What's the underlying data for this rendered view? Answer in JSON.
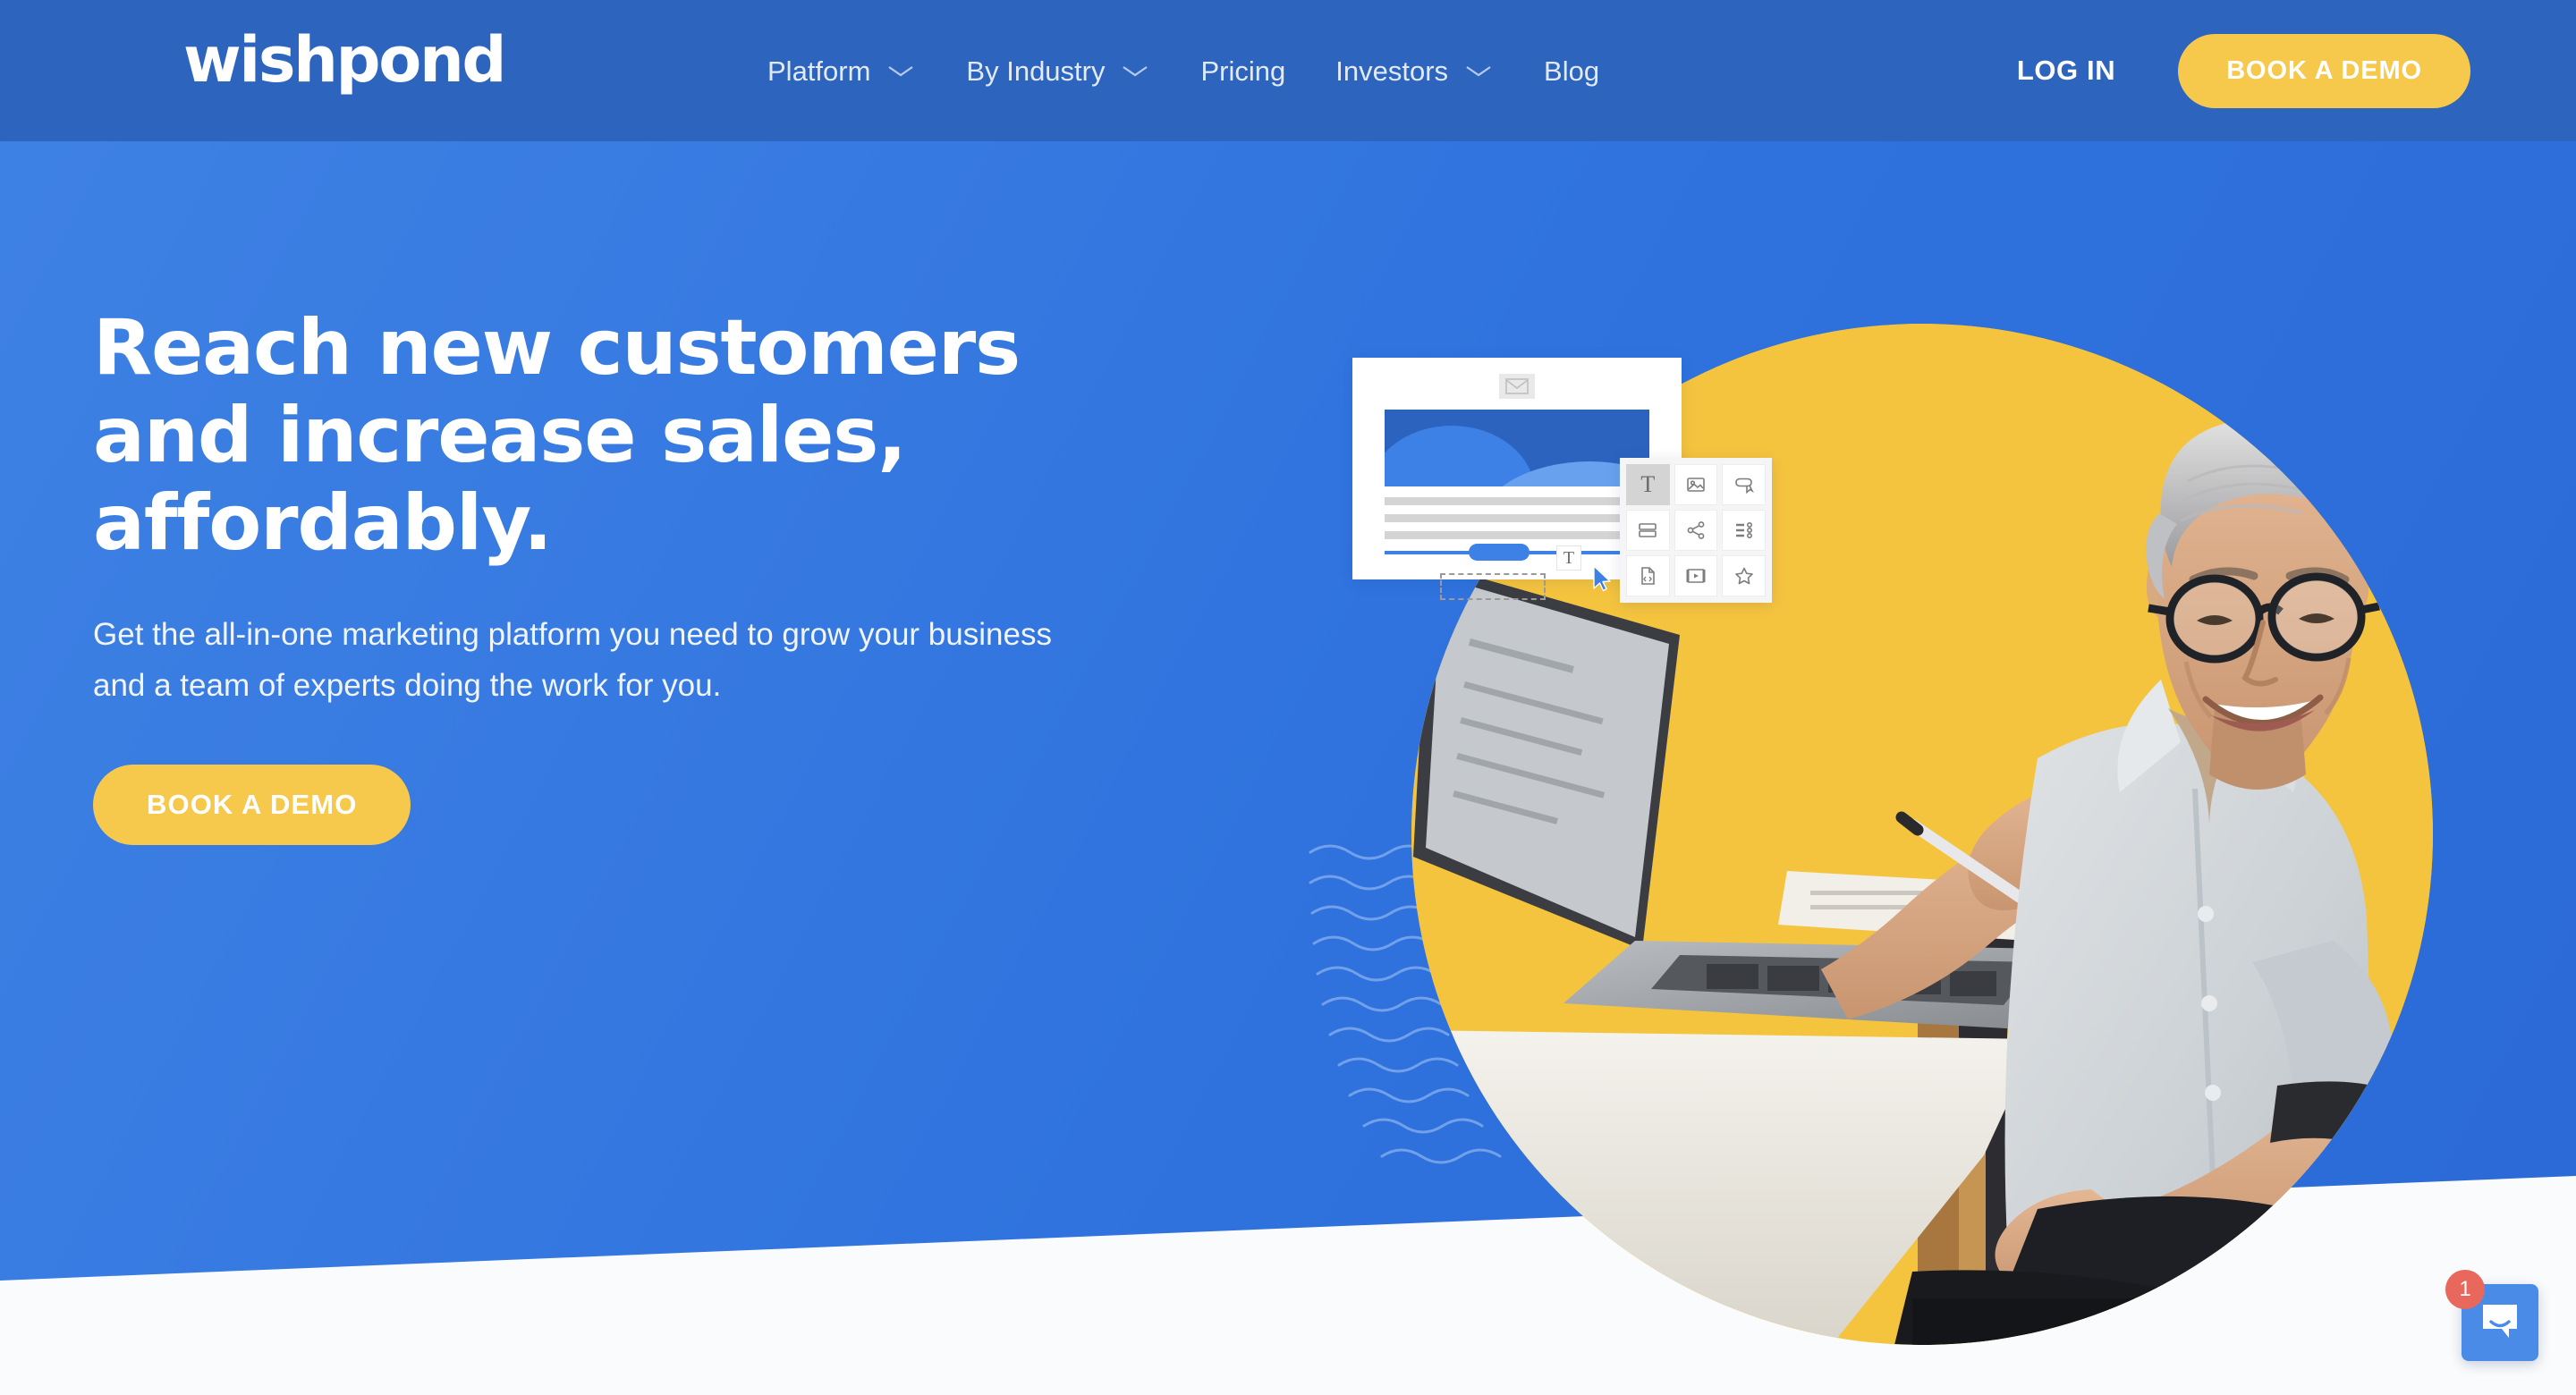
{
  "header": {
    "logo_text": "wishpond",
    "nav_items": [
      {
        "label": "Platform",
        "has_dropdown": true,
        "icon": "chevron-down-icon"
      },
      {
        "label": "By Industry",
        "has_dropdown": true,
        "icon": "chevron-down-icon"
      },
      {
        "label": "Pricing",
        "has_dropdown": false,
        "icon": ""
      },
      {
        "label": "Investors",
        "has_dropdown": true,
        "icon": "chevron-down-icon"
      },
      {
        "label": "Blog",
        "has_dropdown": false,
        "icon": ""
      }
    ],
    "login_label": "LOG IN",
    "demo_button_label": "BOOK A DEMO"
  },
  "hero": {
    "title_line1": "Reach new customers",
    "title_line2": "and increase sales,",
    "title_line3": "affordably.",
    "subtitle": "Get the all-in-one marketing platform you need to grow your business and a team of experts doing the work for you.",
    "cta_label": "BOOK A DEMO"
  },
  "illustration": {
    "mockup_badge_letter": "T",
    "palette_tools": [
      {
        "name": "text-tool-icon",
        "label": "Text",
        "active": true
      },
      {
        "name": "image-tool-icon",
        "label": "Image",
        "active": false
      },
      {
        "name": "callout-tool-icon",
        "label": "Callout",
        "active": false
      },
      {
        "name": "rows-tool-icon",
        "label": "Rows",
        "active": false
      },
      {
        "name": "share-tool-icon",
        "label": "Share",
        "active": false
      },
      {
        "name": "list-tool-icon",
        "label": "List",
        "active": false
      },
      {
        "name": "code-file-tool-icon",
        "label": "Code File",
        "active": false
      },
      {
        "name": "video-tool-icon",
        "label": "Video",
        "active": false
      },
      {
        "name": "star-tool-icon",
        "label": "Star",
        "active": false
      }
    ]
  },
  "chat": {
    "badge_count": "1",
    "icon": "chat-bubble-icon"
  },
  "colors": {
    "header_blue": "#2C64BE",
    "hero_blue": "#3A7BE0",
    "accent_yellow": "#F6C94D",
    "circle_yellow": "#F5C43E",
    "chat_blue": "#4A8BE8",
    "badge_red": "#E8685D",
    "page_white": "#FAFBFC"
  }
}
